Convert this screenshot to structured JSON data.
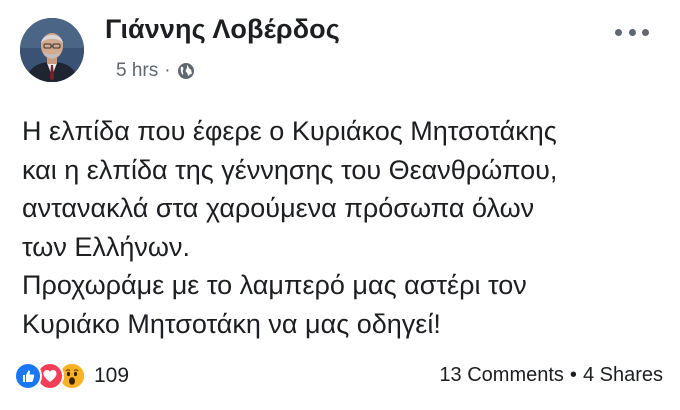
{
  "post": {
    "author": "Γιάννης Λοβέρδος",
    "time": "5 hrs",
    "time_separator": "·",
    "privacy_icon": "globe-icon",
    "more_icon": "more-options-icon",
    "text_lines": [
      "Η ελπίδα που έφερε ο Κυριάκος Μητσοτάκης",
      "και η ελπίδα της γέννησης του Θεανθρώπου,",
      "αντανακλά στα χαρούμενα πρόσωπα όλων",
      "των Ελλήνων.",
      "Προχωράμε με το λαμπερό μας αστέρι τον",
      "Κυριάκο Μητσοτάκη να μας οδηγεί!"
    ]
  },
  "footer": {
    "reactions": [
      "like-icon",
      "love-icon",
      "wow-icon"
    ],
    "reaction_count": "109",
    "comments": "13 Comments",
    "separator": "•",
    "shares": "4 Shares"
  },
  "colors": {
    "text": "#1c1e21",
    "meta": "#606770",
    "like": "#1877f2",
    "love": "#f33e58",
    "wow": "#f7b125"
  }
}
